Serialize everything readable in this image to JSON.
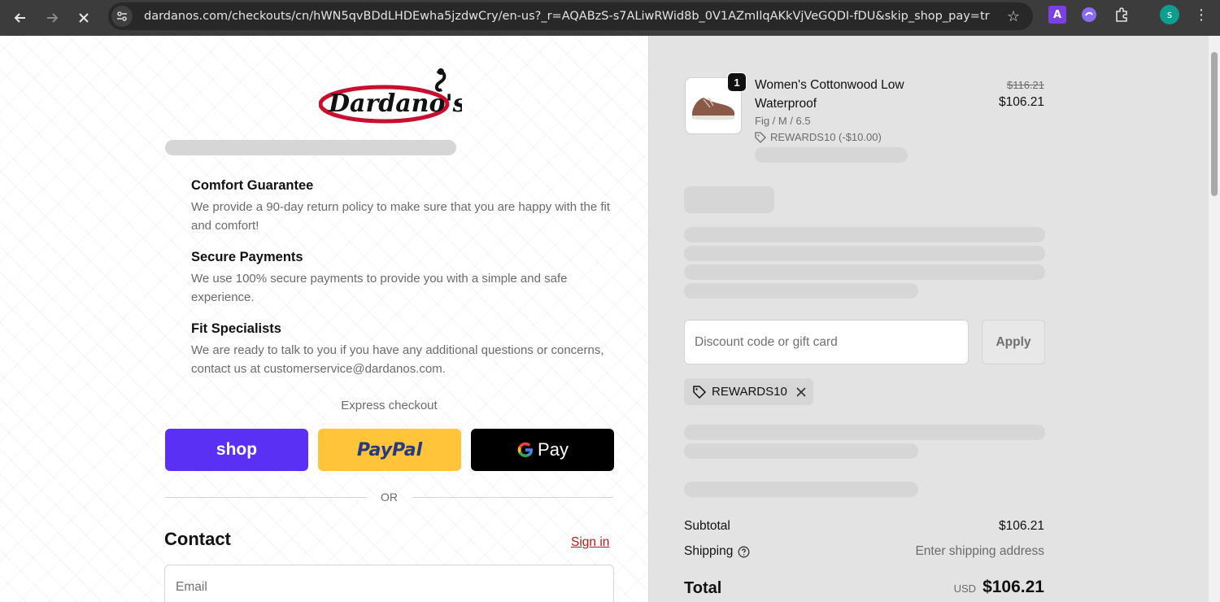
{
  "browser": {
    "url": "dardanos.com/checkouts/cn/hWN5qvBDdLHDEwha5jzdwCry/en-us?_r=AQABzS-s7ALiwRWid8b_0V1AZmIlqAKkVjVeGQDI-fDU&skip_shop_pay=true",
    "profile_initial": "s"
  },
  "brand": {
    "logo_text": "Dardano's"
  },
  "features": [
    {
      "title": "Comfort Guarantee",
      "text": "We provide a 90-day return policy to make sure that you are happy with the fit and comfort!"
    },
    {
      "title": "Secure Payments",
      "text": "We use 100% secure payments to provide you with a simple and safe experience."
    },
    {
      "title": "Fit Specialists",
      "text": "We are ready to talk to you if you have any additional questions or concerns, contact us at customerservice@dardanos.com."
    }
  ],
  "express": {
    "label": "Express checkout",
    "shop_label": "shop",
    "paypal_label": "PayPal",
    "gpay_label": "Pay",
    "or_text": "OR"
  },
  "contact": {
    "title": "Contact",
    "sign_in": "Sign in",
    "email_placeholder": "Email"
  },
  "cart": {
    "quantity": "1",
    "product_name": "Women's Cottonwood Low Waterproof",
    "variant": "Fig / M / 6.5",
    "discount_line": "REWARDS10 (-$10.00)",
    "price_original": "$116.21",
    "price_current": "$106.21"
  },
  "discount": {
    "placeholder": "Discount code or gift card",
    "apply_label": "Apply",
    "applied_code": "REWARDS10"
  },
  "summary": {
    "subtotal_label": "Subtotal",
    "subtotal_value": "$106.21",
    "shipping_label": "Shipping",
    "shipping_value": "Enter shipping address",
    "total_label": "Total",
    "currency": "USD",
    "total_value": "$106.21"
  },
  "colors": {
    "shop_purple": "#5a31f4",
    "paypal_yellow": "#ffc43a",
    "gpay_black": "#000000",
    "brand_red": "#c8102e",
    "link_red": "#b41a1a"
  }
}
